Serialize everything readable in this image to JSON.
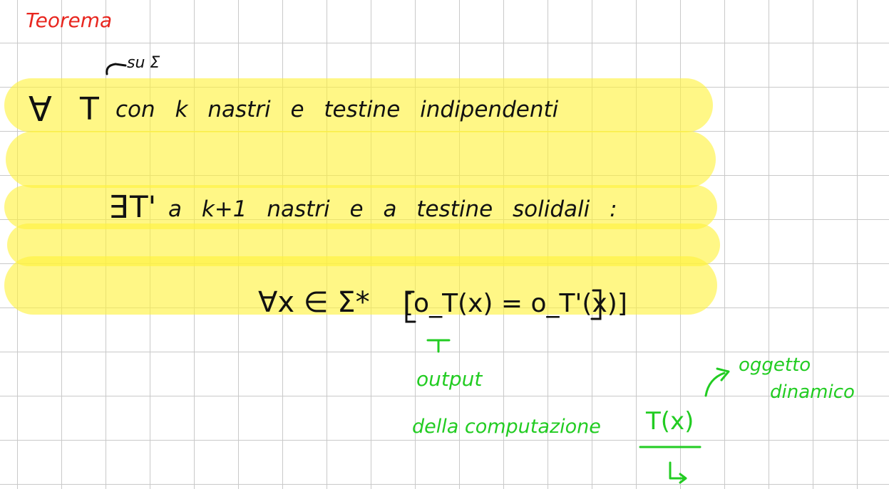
{
  "colors": {
    "black_ink": "#111111",
    "red_ink": "#e8261f",
    "green_ink": "#22cc22",
    "highlight": "#fff23c",
    "grid": "#c9c9c9"
  },
  "title": "Teorema",
  "annotation_alphabet": "su Σ",
  "line1": {
    "forall": "∀",
    "T": "T",
    "rest": "con k nastri e testine indipendenti"
  },
  "line2": {
    "exists": "∃",
    "Tprime": "T'",
    "rest": "a k+1 nastri e a testine solidali :"
  },
  "line3": {
    "quantifier": "∀x ∈ Σ*",
    "formula": "[o_T(x) = o_T'(x)]"
  },
  "notes": {
    "output": "output",
    "della_computazione": "della computazione",
    "Tx": "T(x)",
    "oggetto": "oggetto",
    "dinamico": "dinamico"
  }
}
